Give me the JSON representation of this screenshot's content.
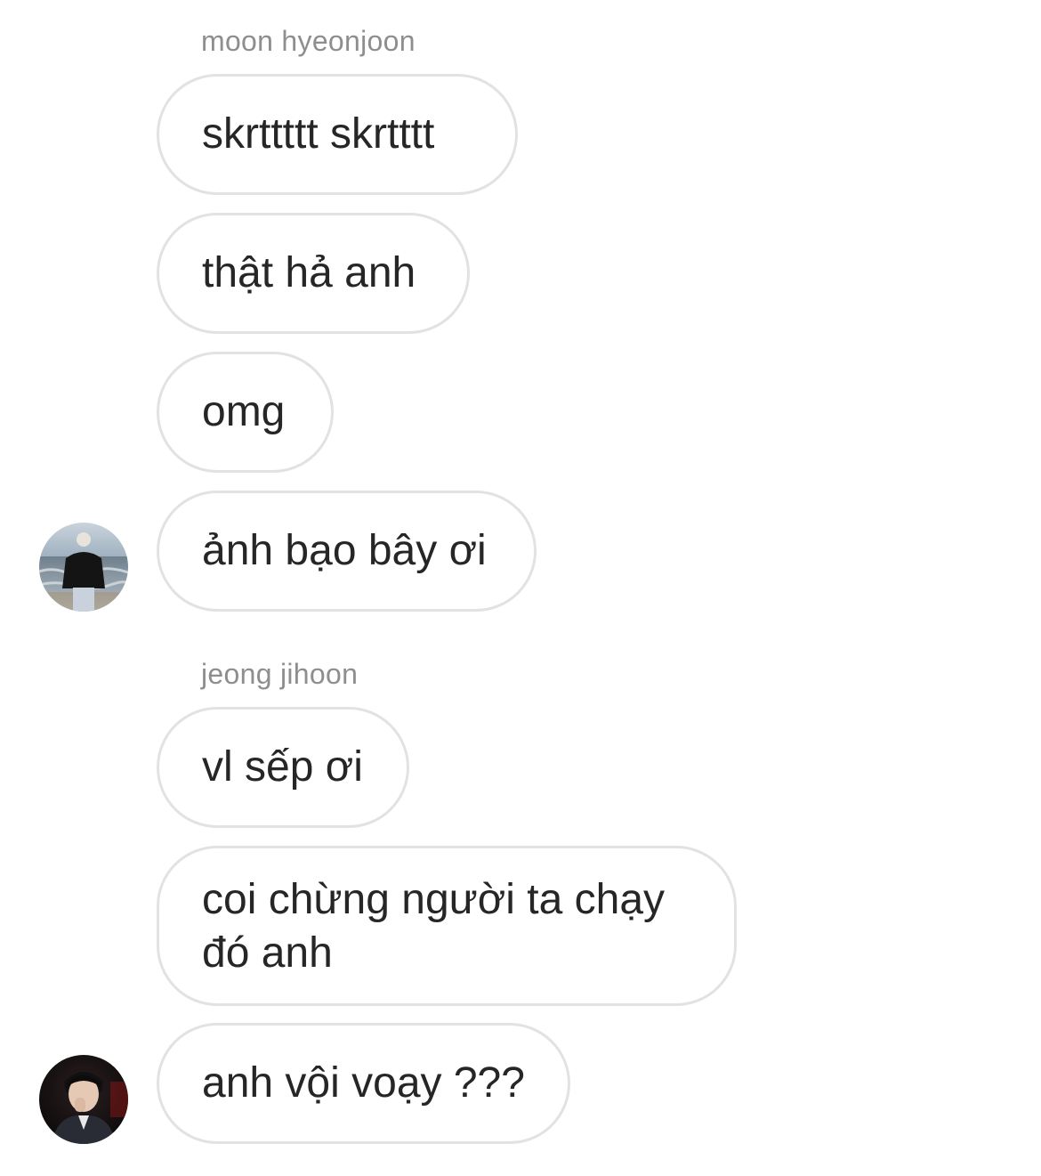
{
  "thread": {
    "groups": [
      {
        "sender": "moon hyeonjoon",
        "avatar_icon": "person-at-sea-avatar",
        "messages": [
          "skrttttt skrtttt",
          "thật hả anh",
          "omg",
          "ảnh bạo bây ơi"
        ]
      },
      {
        "sender": "jeong jihoon",
        "avatar_icon": "person-portrait-avatar",
        "messages": [
          "vl sếp ơi",
          "coi chừng người ta chạy đó anh",
          "anh vội voạy ???"
        ]
      }
    ]
  },
  "colors": {
    "bubble_border": "#e2e2e2",
    "text": "#262626",
    "sender_name": "#8e8e8e",
    "background": "#ffffff"
  }
}
